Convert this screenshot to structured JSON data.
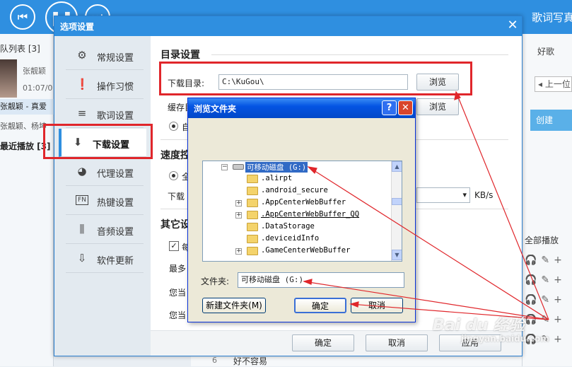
{
  "player": {
    "prev_icon": "⏮",
    "pause_icon": "❚❚",
    "next_icon": "⏭",
    "lyrics_photo_tab": "歌词写真",
    "queue_title": "队列表 [3]",
    "track_artist": "张靓颖",
    "track_time": "01:07/0",
    "list_row_1": "张靓颖 - 真爱",
    "list_row_2": "张靓颖、杨坤",
    "recent_title": "最近播放 [3]",
    "right_tab": "好歌",
    "prev_page": "◂ 上一位",
    "create": "创建",
    "play_all": "全部播放",
    "bottom_song_num": "6",
    "bottom_song_title": "好不容易"
  },
  "options_dialog": {
    "title": "选项设置",
    "close_icon": "✕",
    "nav": [
      {
        "icon": "gear-icon",
        "glyph": "⚙",
        "label": "常规设置"
      },
      {
        "icon": "pin-icon",
        "glyph": "❗",
        "label": "操作习惯"
      },
      {
        "icon": "lyrics-icon",
        "glyph": "≡",
        "label": "歌词设置"
      },
      {
        "icon": "download-icon",
        "glyph": "⬇",
        "label": "下载设置"
      },
      {
        "icon": "globe-icon",
        "glyph": "◕",
        "label": "代理设置"
      },
      {
        "icon": "hotkey-icon",
        "glyph": "FN",
        "label": "热键设置"
      },
      {
        "icon": "equalizer-icon",
        "glyph": "⫼",
        "label": "音频设置"
      },
      {
        "icon": "update-icon",
        "glyph": "⇩",
        "label": "软件更新"
      }
    ],
    "active_nav_index": 3,
    "directory_section": "目录设置",
    "download_dir_label": "下载目录:",
    "download_dir_value": "C:\\KuGou\\",
    "browse_button": "浏览",
    "cache_dir_label": "缓存目",
    "cache_browse_button": "浏览",
    "cache_radio_label": "自",
    "speed_section": "速度控",
    "speed_radio_label": "全",
    "download_limit_label": "下载",
    "speed_unit": "KB/s",
    "other_section": "其它设",
    "other_checkbox_label": "每",
    "max_label": "最多",
    "current_label_1": "您当",
    "current_label_2": "您当",
    "ok_button": "确定",
    "cancel_button": "取消",
    "apply_button": "应用"
  },
  "browse_dialog": {
    "title": "浏览文件夹",
    "help_icon": "?",
    "close_icon": "✕",
    "tree": [
      {
        "label": "可移动磁盘 (G:)",
        "type": "drive",
        "expander": "−",
        "selected": true,
        "level": 0
      },
      {
        "label": ".alirpt",
        "type": "folder",
        "expander": "",
        "selected": false,
        "level": 1
      },
      {
        "label": ".android_secure",
        "type": "folder",
        "expander": "",
        "selected": false,
        "level": 1
      },
      {
        "label": ".AppCenterWebBuffer",
        "type": "folder",
        "expander": "+",
        "selected": false,
        "level": 1
      },
      {
        "label": ".AppCenterWebBuffer_QQ",
        "type": "folder",
        "expander": "+",
        "selected": false,
        "level": 1
      },
      {
        "label": ".DataStorage",
        "type": "folder",
        "expander": "",
        "selected": false,
        "level": 1
      },
      {
        "label": ".deviceidInfo",
        "type": "folder",
        "expander": "",
        "selected": false,
        "level": 1
      },
      {
        "label": ".GameCenterWebBuffer",
        "type": "folder",
        "expander": "+",
        "selected": false,
        "level": 1
      }
    ],
    "folder_label": "文件夹:",
    "folder_value": "可移动磁盘 (G:)",
    "new_folder_button": "新建文件夹(M)",
    "ok_button": "确定",
    "cancel_button": "取消"
  },
  "watermark": {
    "brand": "Bai du 经验",
    "url": "jingyan.baidu.com"
  },
  "colors": {
    "accent": "#2f8fe0",
    "highlight_red": "#e0262b",
    "xp_title": "#0454e3"
  }
}
